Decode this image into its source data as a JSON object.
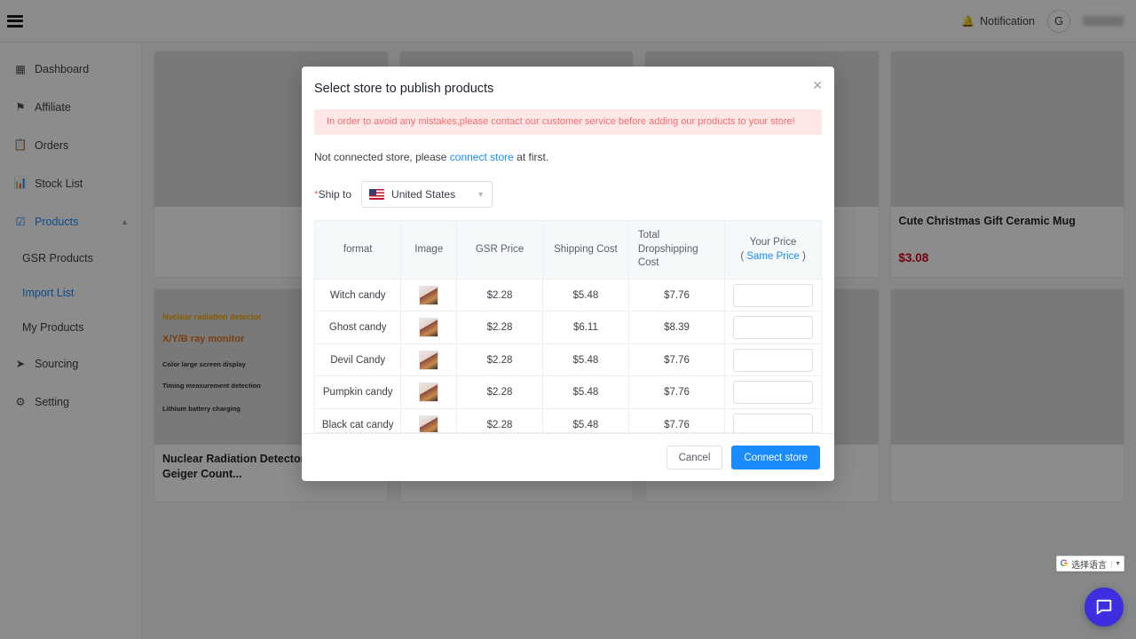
{
  "topbar": {
    "menu_icon": "hamburger-icon",
    "notification_label": "Notification",
    "bell_icon": "bell-icon",
    "avatar_initial": "G"
  },
  "sidebar": {
    "items": [
      {
        "label": "Dashboard",
        "icon": "grid-icon",
        "active": false
      },
      {
        "label": "Affiliate",
        "icon": "flag-icon",
        "active": false
      },
      {
        "label": "Orders",
        "icon": "clipboard-icon",
        "active": false
      },
      {
        "label": "Stock List",
        "icon": "bar-chart-icon",
        "active": false
      },
      {
        "label": "Products",
        "icon": "checkbox-icon",
        "active": true
      },
      {
        "label": "Sourcing",
        "icon": "send-icon",
        "active": false
      },
      {
        "label": "Setting",
        "icon": "gear-icon",
        "active": false
      }
    ],
    "sub_items": [
      {
        "label": "GSR Products",
        "active": false
      },
      {
        "label": "Import List",
        "active": true
      },
      {
        "label": "My Products",
        "active": false
      }
    ],
    "chevron_icon": "chevron-up-icon"
  },
  "products": [
    {
      "title": "",
      "price": "",
      "photo": "ph-people"
    },
    {
      "title": "",
      "price": "",
      "photo": "ph-green"
    },
    {
      "title": "",
      "price": "",
      "photo": "ph-skin"
    },
    {
      "title": "Cute Christmas Gift Ceramic Mug",
      "price": "$3.08",
      "photo": "ph-mug"
    },
    {
      "title": "Nuclear Radiation Detector Radioactive Geiger Count...",
      "price": "",
      "photo": "ph-detector"
    },
    {
      "title": "",
      "price": "",
      "photo": "ph-halloween"
    },
    {
      "title": "",
      "price": "",
      "photo": "ph-necklace"
    },
    {
      "title": "",
      "price": "",
      "photo": "ph-pendant"
    }
  ],
  "detector_card": {
    "kicker": "Nuclear radiation detector",
    "headline": "X/Y/B ray monitor",
    "bullets": [
      "Color large screen display",
      "Timing measurement detection",
      "Lithium battery charging"
    ]
  },
  "modal": {
    "title": "Select store to publish products",
    "close_icon": "close-icon",
    "warning": "In order to avoid any mistakes,please contact our customer service before adding our products to your store!",
    "note_prefix": "Not connected store, please ",
    "note_link": "connect store",
    "note_suffix": " at first.",
    "ship_to_label": "Ship to",
    "ship_to_required": "*",
    "ship_to_value": "United States",
    "flag_icon": "us-flag-icon",
    "dropdown_icon": "chevron-down-icon",
    "table": {
      "columns": [
        "format",
        "Image",
        "GSR Price",
        "Shipping Cost",
        "Total Dropshipping Cost",
        "Your Price"
      ],
      "your_price_sub_open": "( ",
      "your_price_sub_link": "Same Price",
      "your_price_sub_close": " )",
      "rows": [
        {
          "format": "Witch candy",
          "gsr_price": "$2.28",
          "shipping_cost": "$5.48",
          "total_cost": "$7.76",
          "your_price": ""
        },
        {
          "format": "Ghost candy",
          "gsr_price": "$2.28",
          "shipping_cost": "$6.11",
          "total_cost": "$8.39",
          "your_price": ""
        },
        {
          "format": "Devil Candy",
          "gsr_price": "$2.28",
          "shipping_cost": "$5.48",
          "total_cost": "$7.76",
          "your_price": ""
        },
        {
          "format": "Pumpkin candy",
          "gsr_price": "$2.28",
          "shipping_cost": "$5.48",
          "total_cost": "$7.76",
          "your_price": ""
        },
        {
          "format": "Black cat candy",
          "gsr_price": "$2.28",
          "shipping_cost": "$5.48",
          "total_cost": "$7.76",
          "your_price": ""
        }
      ]
    },
    "cancel_label": "Cancel",
    "submit_label": "Connect store"
  },
  "widgets": {
    "translate_brand": "G",
    "translate_label": "选择语言",
    "translate_arrow": "▼",
    "chat_icon": "chat-bubble-icon"
  },
  "colors": {
    "accent": "#1a8cff",
    "warning_bg": "#fde7e7",
    "warning_text": "#f56c6c",
    "price": "#d0021b",
    "chat_bg": "#3d2fe0"
  }
}
